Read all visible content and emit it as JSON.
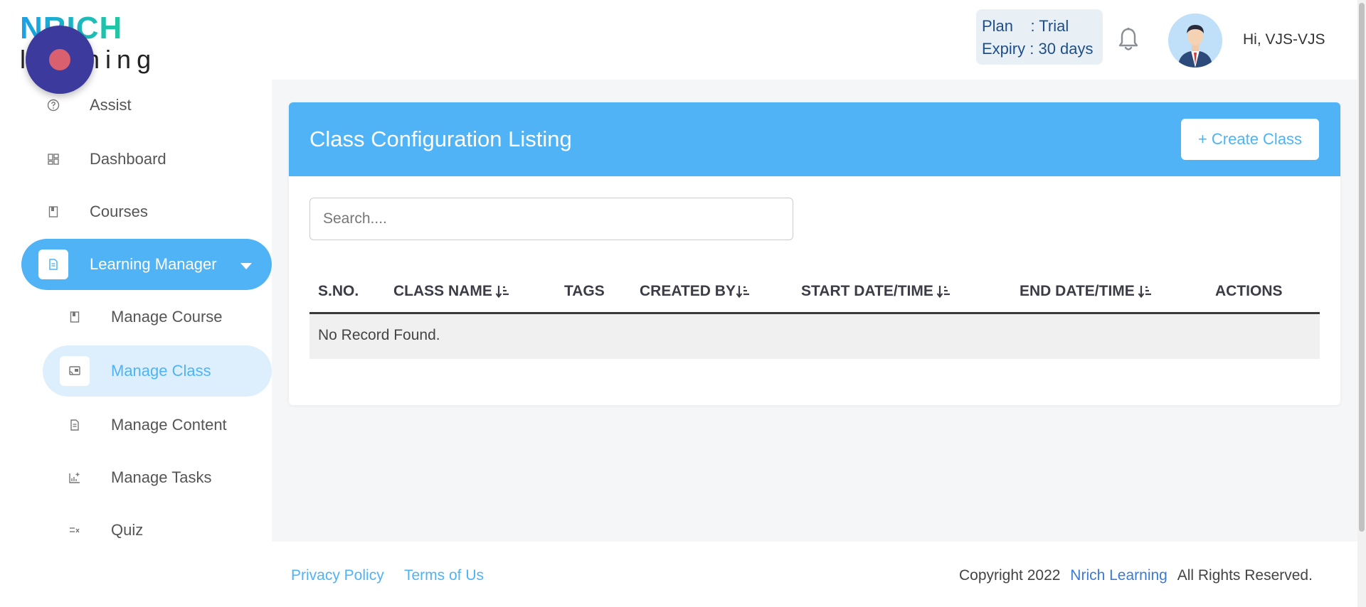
{
  "header": {
    "logo_top": "NRICH",
    "logo_bottom": "learning",
    "plan_line1": "Plan    : Trial",
    "plan_line2": "Expiry : 30 days",
    "greeting": "Hi, VJS-VJS"
  },
  "sidebar": {
    "items": [
      {
        "label": "Assist",
        "icon": "help-circle-icon"
      },
      {
        "label": "Dashboard",
        "icon": "dashboard-grid-icon"
      },
      {
        "label": "Courses",
        "icon": "book-icon"
      },
      {
        "label": "Learning Manager",
        "icon": "document-icon"
      },
      {
        "label": "Manage Course",
        "icon": "book-icon"
      },
      {
        "label": "Manage Class",
        "icon": "cast-icon"
      },
      {
        "label": "Manage Content",
        "icon": "document-icon"
      },
      {
        "label": "Manage Tasks",
        "icon": "chart-plus-icon"
      },
      {
        "label": "Quiz",
        "icon": "list-check-icon"
      }
    ]
  },
  "main": {
    "title": "Class Configuration Listing",
    "create_button": "+ Create Class",
    "search_placeholder": "Search....",
    "columns": [
      "S.NO.",
      "CLASS NAME",
      "TAGS",
      "CREATED BY",
      "START DATE/TIME",
      "END DATE/TIME",
      "ACTIONS"
    ],
    "empty_message": "No Record Found."
  },
  "footer": {
    "privacy": "Privacy Policy",
    "terms": "Terms of Us",
    "copyright_prefix": "Copyright 2022",
    "brand": "Nrich Learning",
    "rights": "All Rights Reserved."
  },
  "colors": {
    "accent": "#4fb3f6",
    "fab": "#3d3a9e",
    "plan_text": "#1f4f8a"
  }
}
